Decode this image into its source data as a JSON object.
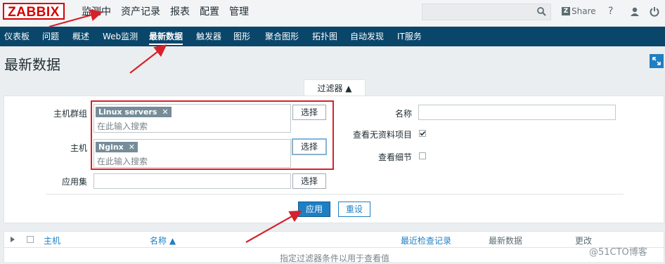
{
  "logo": "ZABBIX",
  "top_menu": [
    "监测中",
    "资产记录",
    "报表",
    "配置",
    "管理"
  ],
  "top_right": {
    "share": "Share",
    "help": "?"
  },
  "sub_menu": [
    "仪表板",
    "问题",
    "概述",
    "Web监测",
    "最新数据",
    "触发器",
    "图形",
    "聚合图形",
    "拓扑图",
    "自动发现",
    "IT服务"
  ],
  "page_title": "最新数据",
  "filter": {
    "tab_label": "过滤器 ▲",
    "host_group_label": "主机群组",
    "host_group_tag": "Linux servers",
    "host_label": "主机",
    "host_tag": "Nginx",
    "search_placeholder": "在此输入搜索",
    "select_label": "选择",
    "app_label": "应用集",
    "name_label": "名称",
    "name_value": "",
    "show_no_data_label": "查看无资料项目",
    "show_no_data_checked": true,
    "show_details_label": "查看细节",
    "show_details_checked": false,
    "apply_label": "应用",
    "reset_label": "重设"
  },
  "table": {
    "columns": [
      "主机",
      "名称 ▲",
      "最近检查记录",
      "最新数据",
      "更改"
    ],
    "empty_text": "指定过滤器条件以用于查看值"
  },
  "watermark": "@51CTO博客",
  "colors": {
    "nav_dark": "#0a466a",
    "accent_blue": "#1f7fc3",
    "annotation_red": "#d6222a",
    "logo_red": "#d40000"
  }
}
